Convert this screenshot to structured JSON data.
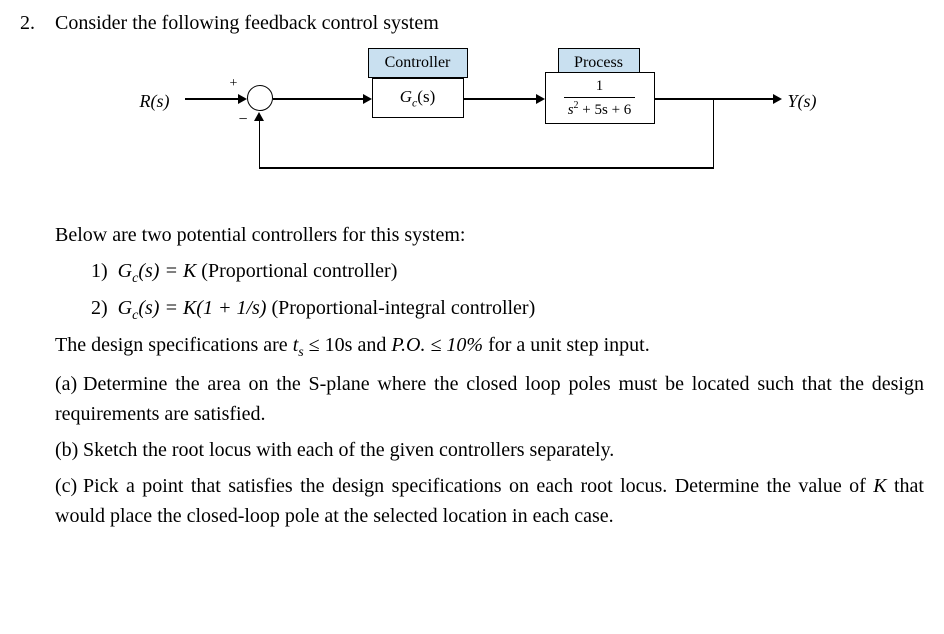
{
  "problem": {
    "number": "2.",
    "intro": "Consider the following feedback control system"
  },
  "diagram": {
    "input_label": "R(s)",
    "output_label": "Y(s)",
    "controller_title": "Controller",
    "process_title": "Process",
    "controller_tf": "G",
    "controller_tf_sub": "c",
    "controller_tf_arg": "(s)",
    "process_num": "1",
    "process_den_s2": "s",
    "process_den_rest": " + 5s + 6",
    "plus": "+",
    "minus": "−"
  },
  "body": {
    "below_text": "Below are two potential controllers for this system:",
    "opt1_num": "1)",
    "opt1_eq_lhs": "G",
    "opt1_eq_sub": "c",
    "opt1_eq_arg": "(s) = K",
    "opt1_desc": " (Proportional controller)",
    "opt2_num": "2)",
    "opt2_eq_lhs": "G",
    "opt2_eq_sub": "c",
    "opt2_eq_arg": "(s) = K(1 + 1/s)",
    "opt2_desc": " (Proportional-integral controller)",
    "spec_pre": "The design specifications are ",
    "spec_ts": "t",
    "spec_ts_sub": "s",
    "spec_ts_rest": " ≤ 10s",
    "spec_and": " and ",
    "spec_po": "P.O. ≤ 10%",
    "spec_post": " for a unit step input."
  },
  "parts": {
    "a_label": "(a)",
    "a_text": "Determine the area on the S-plane where the closed loop poles must be located such that the design requirements are satisfied.",
    "b_label": "(b)",
    "b_text": "Sketch the root locus with each of the given controllers separately.",
    "c_label": "(c)",
    "c_text_1": "Pick a point that satisfies the design specifications on each root locus. Determine the value of ",
    "c_K": "K",
    "c_text_2": " that would place the closed-loop pole at the selected location in each case."
  }
}
